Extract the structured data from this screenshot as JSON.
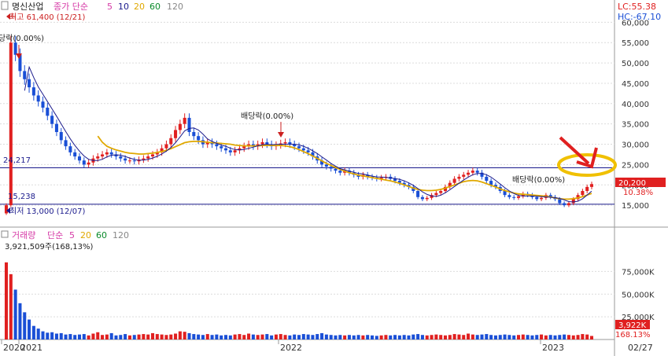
{
  "header": {
    "stock_name": "명신산업",
    "price_label": "종가 단순",
    "ma_periods": [
      "5",
      "10",
      "20",
      "60",
      "120"
    ],
    "ma_colors": [
      "#d63aa6",
      "#1a1a8c",
      "#e0a800",
      "#0a8a2a",
      "#888888"
    ]
  },
  "right_info": {
    "lc": "LC:55.38",
    "hc": "HC:-67.10"
  },
  "volume_header": {
    "title": "거래량",
    "label": "단순",
    "periods": [
      "5",
      "20",
      "60",
      "120"
    ],
    "value": "3,921,509주(168,13%)"
  },
  "annotations": {
    "high": "최고 61,400 (12/21)",
    "low": "최저 13,000 (12/07)",
    "div1": "당락(0.00%)",
    "div2": "배당락(0.00%)",
    "div3": "배당락(0.00%)",
    "hline1": "24,217",
    "hline2": "15,238"
  },
  "price_tags": {
    "last": "20,200",
    "pct": "10.38%"
  },
  "volume_tags": {
    "last": "3,922K",
    "pct": "168.13%"
  },
  "colors": {
    "up": "#e02020",
    "down": "#1a4fd6",
    "hline": "#1a1a8c",
    "ellipse": "#f0c000",
    "arrow": "#e02020",
    "grid": "#dcdcdc",
    "tag": "#e02020"
  },
  "chart_data": {
    "type": "candlestick",
    "price_axis": {
      "ylim": [
        10000,
        62000
      ],
      "ticks": [
        15000,
        20000,
        25000,
        30000,
        35000,
        40000,
        45000,
        50000,
        55000,
        60000
      ],
      "tick_labels": [
        "15,000",
        "20,000",
        "25,000",
        "30,000",
        "35,000",
        "40,000",
        "45,000",
        "50,000",
        "55,000",
        "60,000"
      ]
    },
    "volume_axis": {
      "ylim": [
        0,
        110000
      ],
      "ticks": [
        25000,
        50000,
        75000
      ],
      "tick_labels": [
        "25,000K",
        "50,000K",
        "75,000K"
      ]
    },
    "x_labels": [
      "2020",
      "2021",
      "2022",
      "2023",
      "02/27"
    ],
    "horizontal_lines": [
      24217,
      15238
    ],
    "price_series": {
      "close": [
        15000,
        55000,
        52000,
        48000,
        46000,
        44000,
        42000,
        40500,
        39000,
        37000,
        35000,
        33000,
        31000,
        29500,
        28000,
        27000,
        26000,
        25000,
        25500,
        26500,
        27000,
        27500,
        28000,
        27500,
        27000,
        26500,
        26000,
        26000,
        25800,
        26200,
        26500,
        27000,
        27500,
        28000,
        29000,
        30000,
        31500,
        33500,
        35000,
        36500,
        33000,
        32000,
        31000,
        30000,
        30500,
        30000,
        29500,
        29000,
        28500,
        28000,
        28500,
        29000,
        29500,
        30000,
        29500,
        30000,
        30500,
        30000,
        29500,
        29800,
        30200,
        30500,
        30000,
        29500,
        29000,
        28500,
        28000,
        27000,
        26000,
        25000,
        24500,
        24000,
        23500,
        23000,
        23500,
        23000,
        22500,
        22000,
        22500,
        22000,
        21800,
        21500,
        21800,
        22000,
        21500,
        21000,
        20500,
        20000,
        19500,
        18500,
        17000,
        16500,
        16800,
        17500,
        18000,
        18500,
        19500,
        20500,
        21500,
        22000,
        22500,
        23000,
        23500,
        23000,
        22000,
        21000,
        20000,
        19500,
        18500,
        17500,
        17000,
        16800,
        17200,
        17800,
        17500,
        17000,
        16500,
        16800,
        17500,
        17000,
        16500,
        15500,
        15000,
        15500,
        16500,
        17500,
        18500,
        19500,
        20200
      ],
      "ma20": [
        null,
        null,
        null,
        null,
        null,
        null,
        null,
        null,
        null,
        null,
        null,
        null,
        null,
        null,
        null,
        null,
        null,
        null,
        null,
        null,
        32000,
        30500,
        29500,
        29000,
        28600,
        28300,
        28000,
        27800,
        27700,
        27600,
        27600,
        27700,
        27800,
        28000,
        28200,
        28500,
        28900,
        29400,
        29900,
        30400,
        30600,
        30700,
        30700,
        30600,
        30500,
        30400,
        30300,
        30200,
        30100,
        30000,
        29800,
        29700,
        29600,
        29600,
        29600,
        29600,
        29700,
        29700,
        29700,
        29700,
        29700,
        29600,
        29400,
        29100,
        28700,
        28200,
        27700,
        27100,
        26500,
        25900,
        25300,
        24800,
        24300,
        23800,
        23400,
        23000,
        22700,
        22400,
        22200,
        22000,
        21800,
        21600,
        21400,
        21200,
        21000,
        20700,
        20400,
        20000,
        19600,
        19200,
        18900,
        18700,
        18600,
        18600,
        18700,
        18900,
        19200,
        19600,
        20000,
        20400,
        20800,
        21000,
        21100,
        21000,
        20700,
        20300,
        19900,
        19500,
        19000,
        18600,
        18300,
        18000,
        17800,
        17700,
        17600,
        17500,
        17400,
        17300,
        17200,
        17000,
        16800,
        16600,
        16500,
        16500,
        16600,
        16800,
        17100,
        17500,
        17900
      ]
    },
    "volume_series": {
      "values": [
        85000,
        72000,
        55000,
        40000,
        30000,
        22000,
        15000,
        12000,
        9000,
        7500,
        8000,
        6500,
        7000,
        5500,
        6000,
        5000,
        5500,
        6000,
        4500,
        6500,
        8000,
        5000,
        5500,
        7000,
        4500,
        5000,
        6000,
        4500,
        5000,
        5500,
        6000,
        5500,
        7000,
        6000,
        5500,
        5000,
        5500,
        6500,
        9000,
        8500,
        7000,
        6000,
        5500,
        5000,
        6000,
        5000,
        5500,
        4500,
        5000,
        4500,
        5500,
        6000,
        5000,
        6500,
        5500,
        5000,
        5500,
        6000,
        4500,
        5500,
        6000,
        5000,
        4500,
        5500,
        5000,
        6000,
        5500,
        5000,
        6000,
        7000,
        5500,
        5000,
        4500,
        5000,
        4500,
        5000,
        4500,
        5000,
        4500,
        5000,
        4500,
        4000,
        4500,
        5000,
        4500,
        5000,
        4500,
        5000,
        4500,
        5500,
        6000,
        5000,
        4500,
        5000,
        5500,
        5000,
        4500,
        5000,
        6000,
        5500,
        5000,
        6500,
        5500,
        5000,
        5500,
        6000,
        5000,
        4500,
        5000,
        5500,
        5000,
        4500,
        5000,
        5500,
        5000,
        4500,
        5000,
        5500,
        4500,
        5000,
        4500,
        5000,
        5500,
        5000,
        4500,
        5000,
        6000,
        5500,
        3922
      ]
    }
  }
}
